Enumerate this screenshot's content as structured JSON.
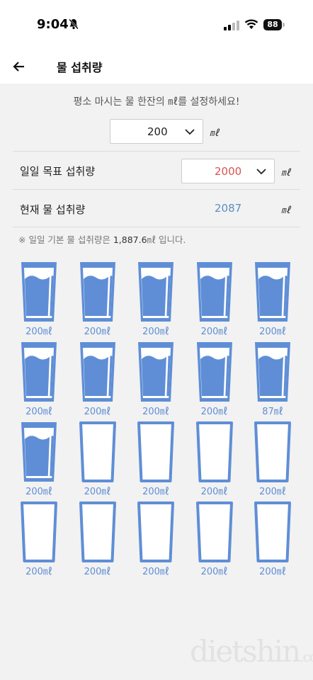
{
  "status_bar": {
    "time": "9:04",
    "battery": "88"
  },
  "header": {
    "title": "물 섭취량"
  },
  "intro_text": "평소 마시는 물 한잔의 ㎖를 설정하세요!",
  "cup_size": {
    "value": "200",
    "unit": "㎖"
  },
  "goal": {
    "label": "일일 목표 섭취량",
    "value": "2000",
    "unit": "㎖",
    "value_color": "#d9534f"
  },
  "current": {
    "label": "현재 물 섭취량",
    "value": "2087",
    "unit": "㎖",
    "value_color": "#5c8fc0"
  },
  "note": {
    "prefix": "※ 일일 기본 물 섭취량은 ",
    "amount": "1,887.6",
    "suffix": "㎖ 입니다."
  },
  "accent_color": "#5f8ed6",
  "cups": [
    {
      "label": "200㎖",
      "fill": 1
    },
    {
      "label": "200㎖",
      "fill": 1
    },
    {
      "label": "200㎖",
      "fill": 1
    },
    {
      "label": "200㎖",
      "fill": 1
    },
    {
      "label": "200㎖",
      "fill": 1
    },
    {
      "label": "200㎖",
      "fill": 1
    },
    {
      "label": "200㎖",
      "fill": 1
    },
    {
      "label": "200㎖",
      "fill": 1
    },
    {
      "label": "200㎖",
      "fill": 1
    },
    {
      "label": "87㎖",
      "fill": 1
    },
    {
      "label": "200㎖",
      "fill": 1
    },
    {
      "label": "200㎖",
      "fill": 0
    },
    {
      "label": "200㎖",
      "fill": 0
    },
    {
      "label": "200㎖",
      "fill": 0
    },
    {
      "label": "200㎖",
      "fill": 0
    },
    {
      "label": "200㎖",
      "fill": 0
    },
    {
      "label": "200㎖",
      "fill": 0
    },
    {
      "label": "200㎖",
      "fill": 0
    },
    {
      "label": "200㎖",
      "fill": 0
    },
    {
      "label": "200㎖",
      "fill": 0
    }
  ],
  "watermark": {
    "main": "dietshin",
    "suffix": ".com"
  }
}
